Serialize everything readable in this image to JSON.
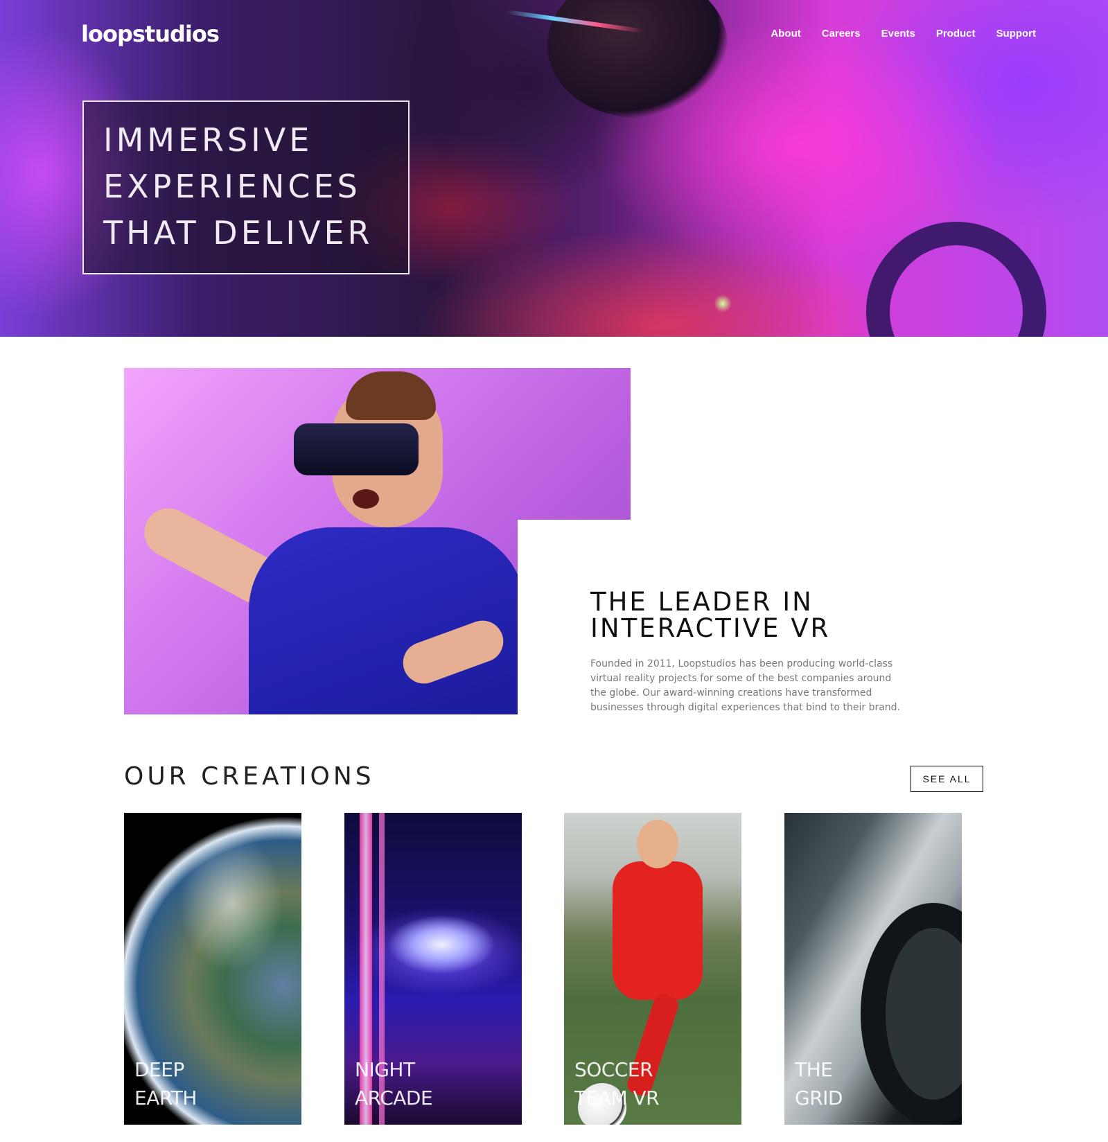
{
  "header": {
    "logo": "loopstudios",
    "nav": [
      "About",
      "Careers",
      "Events",
      "Product",
      "Support"
    ]
  },
  "hero": {
    "title_lines": [
      "IMMERSIVE",
      "EXPERIENCES",
      "THAT DELIVER"
    ]
  },
  "about": {
    "title_lines": [
      "THE LEADER IN",
      "INTERACTIVE VR"
    ],
    "text": "Founded in 2011, Loopstudios has been producing world-class virtual reality projects for some of the best companies around the globe. Our award-winning creations have transformed businesses through digital experiences that bind to their brand."
  },
  "creations": {
    "title": "OUR CREATIONS",
    "see_all": "SEE ALL",
    "items": [
      {
        "lines": [
          "DEEP",
          "EARTH"
        ]
      },
      {
        "lines": [
          "NIGHT",
          "ARCADE"
        ]
      },
      {
        "lines": [
          "SOCCER",
          "TEAM VR"
        ]
      },
      {
        "lines": [
          "THE",
          "GRID"
        ]
      }
    ]
  }
}
